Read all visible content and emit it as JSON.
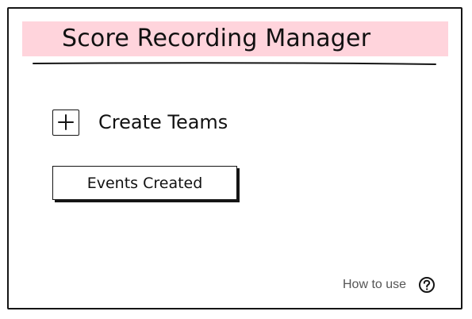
{
  "header": {
    "title": "Score Recording Manager"
  },
  "main": {
    "create_teams_label": "Create Teams",
    "events_created_label": "Events Created"
  },
  "footer": {
    "help_label": "How to use",
    "help_icon": "question-circle-icon"
  },
  "icons": {
    "create_teams_icon": "plus-icon"
  },
  "colors": {
    "title_highlight": "#ffd4dc",
    "line": "#151515",
    "help_text": "#555555"
  }
}
